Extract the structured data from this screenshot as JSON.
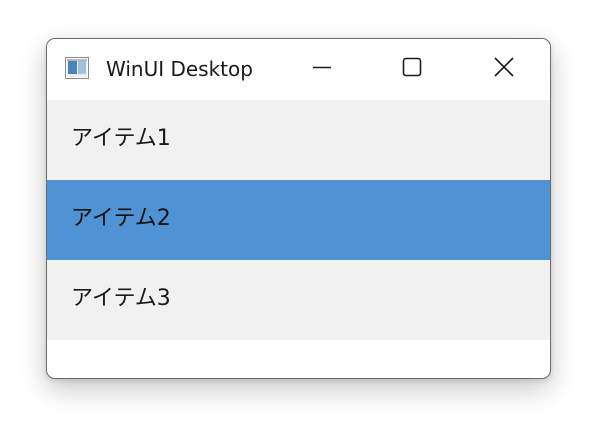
{
  "window": {
    "title": "WinUI Desktop",
    "icons": {
      "app": "app-window-icon",
      "minimize": "minimize-icon",
      "maximize": "maximize-icon",
      "close": "close-icon"
    }
  },
  "list": {
    "items": [
      {
        "label": "アイテム1",
        "selected": false
      },
      {
        "label": "アイテム2",
        "selected": true
      },
      {
        "label": "アイテム3",
        "selected": false
      }
    ]
  },
  "colors": {
    "selected_background": "#4f93d4",
    "item_background": "#f1f1f1",
    "window_background": "#ffffff"
  }
}
